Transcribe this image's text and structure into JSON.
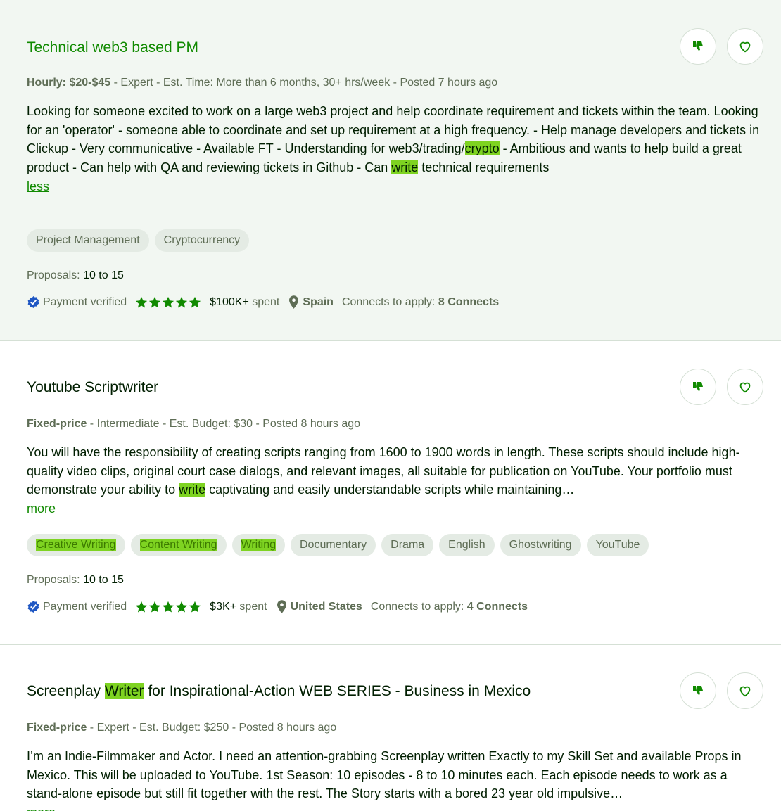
{
  "jobs": [
    {
      "title_parts": [
        "Technical web3 based PM"
      ],
      "meta_type": "Hourly: $20-$45",
      "meta_rest": " - Expert - Est. Time: More than 6 months, 30+ hrs/week - Posted 7 hours ago",
      "description": {
        "p1": "Looking for someone excited to work on a large web3 project and help coordinate requirement and tickets within the team. Looking for an 'operator' - someone able to coordinate and set up requirement at a high frequency. - Help manage developers and tickets in Clickup - Very communicative - Available FT - Understanding for web3/trading/",
        "hl1": "crypto",
        "p2": " - Ambitious and wants to help build a great product - Can help with QA and reviewing tickets in Github - Can ",
        "hl2": "write",
        "p3": " technical requirements"
      },
      "toggle_label": "less",
      "tags": [
        "Project Management",
        "Cryptocurrency"
      ],
      "proposals_label": "Proposals: ",
      "proposals_value": "10 to 15",
      "payment_label": "Payment verified",
      "rating": 5,
      "spent_amount": "$100K+",
      "spent_suffix": " spent",
      "location": "Spain",
      "connects_label": "Connects to apply: ",
      "connects_value": "8 Connects"
    },
    {
      "title": "Youtube Scriptwriter",
      "meta_type": "Fixed-price",
      "meta_rest": " - Intermediate - Est. Budget: $30 - Posted 8 hours ago",
      "description": {
        "p1": "You will have the responsibility of creating scripts ranging from 1600 to 1900 words in length. These scripts should include high-quality video clips, original court case dialogs, and relevant images, all suitable for publication on YouTube. Your portfolio must demonstrate your ability to ",
        "hl1": "write",
        "p2": " captivating and easily understandable scripts while maintaining…"
      },
      "toggle_label": "more",
      "tags_highlighted": [
        "Creative Writing",
        "Content Writing",
        "Writing"
      ],
      "tags": [
        "Documentary",
        "Drama",
        "English",
        "Ghostwriting",
        "YouTube"
      ],
      "proposals_label": "Proposals: ",
      "proposals_value": "10 to 15",
      "payment_label": "Payment verified",
      "rating": 5,
      "spent_amount": "$3K+",
      "spent_suffix": " spent",
      "location": "United States",
      "connects_label": "Connects to apply: ",
      "connects_value": "4 Connects"
    },
    {
      "title_pre": "Screenplay ",
      "title_hl": "Writer",
      "title_post": " for Inspirational-Action WEB SERIES - Business in Mexico",
      "meta_type": "Fixed-price",
      "meta_rest": " - Expert - Est. Budget: $250 - Posted 8 hours ago",
      "description": {
        "p1": "I’m an Indie-Filmmaker and Actor. I need an attention-grabbing Screenplay written Exactly to my Skill Set and available Props in Mexico. This will be uploaded to YouTube. 1st Season: 10 episodes - 8 to 10 minutes each. Each episode needs to work as a stand-alone episode but still fit together with the rest. The Story starts with a bored 23 year old impulsive…"
      },
      "toggle_label": "more"
    }
  ],
  "colors": {
    "accent_green": "#108a00",
    "highlight": "#7ed321",
    "verified_blue": "#1f57c3"
  },
  "icons": {
    "dislike": "thumbs-down-icon",
    "save": "heart-icon",
    "verified": "verified-badge-icon",
    "star": "star-icon",
    "location": "map-pin-icon"
  }
}
